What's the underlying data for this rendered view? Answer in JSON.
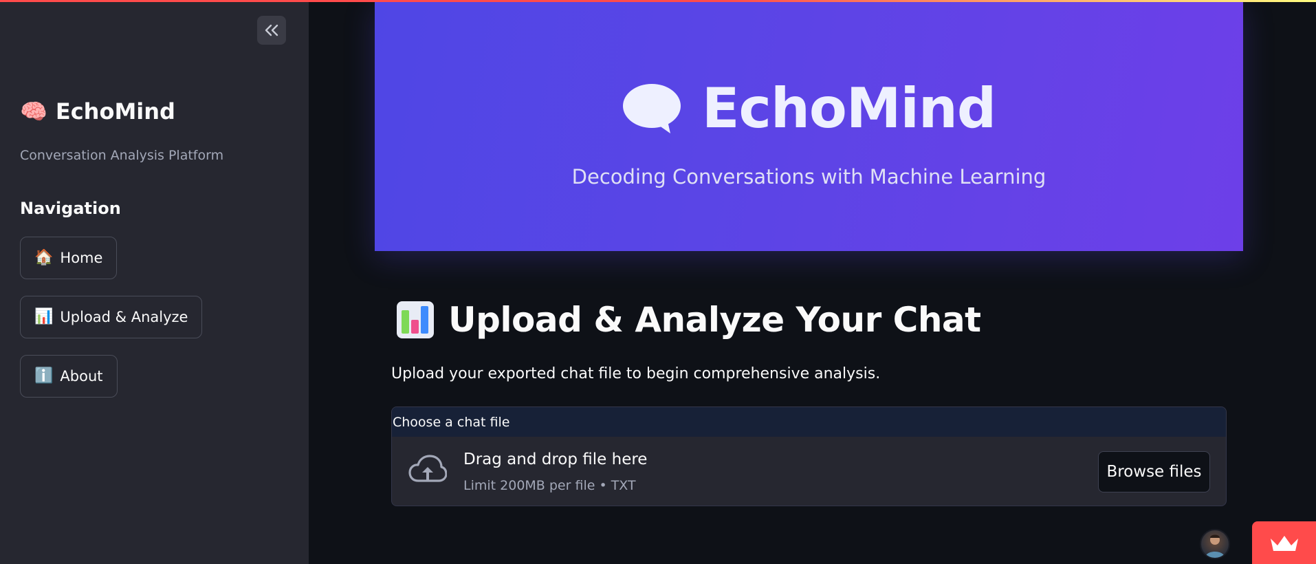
{
  "sidebar": {
    "brand_emoji": "🧠",
    "brand_title": "EchoMind",
    "brand_subtitle": "Conversation Analysis Platform",
    "nav_heading": "Navigation",
    "nav_items": [
      {
        "emoji": "🏠",
        "label": "Home"
      },
      {
        "emoji": "📊",
        "label": "Upload & Analyze"
      },
      {
        "emoji": "ℹ️",
        "label": "About"
      }
    ],
    "collapse_icon": "double-chevron-left-icon"
  },
  "hero": {
    "title": "EchoMind",
    "subtitle": "Decoding Conversations with Machine Learning",
    "icon": "speech-bubble-icon"
  },
  "main": {
    "section_emoji": "📊",
    "section_title": "Upload & Analyze Your Chat",
    "description": "Upload your exported chat file to begin comprehensive analysis.",
    "uploader": {
      "label": "Choose a chat file",
      "drop_text": "Drag and drop file here",
      "limit_text": "Limit 200MB per file • TXT",
      "browse_label": "Browse files",
      "icon": "cloud-upload-icon"
    }
  },
  "footer": {
    "avatar_icon": "user-avatar",
    "badge_icon": "crown-icon"
  },
  "colors": {
    "background": "#0e1117",
    "sidebar": "#262730",
    "hero_start": "#4f46e5",
    "hero_end": "#6d3fe8",
    "accent": "#ff4b4b"
  }
}
